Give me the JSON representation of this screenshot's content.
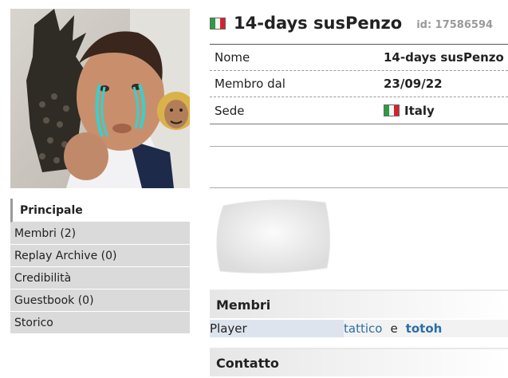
{
  "profile": {
    "title": "14-days susPenzo",
    "id_label": "id: 17586594",
    "country_flag": "italy-flag-icon"
  },
  "info": {
    "rows": [
      {
        "label": "Nome",
        "value": "14-days susPenzo"
      },
      {
        "label": "Membro dal",
        "value": "23/09/22"
      },
      {
        "label": "Sede",
        "value": "Italy"
      }
    ]
  },
  "sidebar": {
    "items": [
      {
        "label": "Principale",
        "active": true
      },
      {
        "label": "Membri (2)"
      },
      {
        "label": "Replay Archive (0)"
      },
      {
        "label": "Credibilità"
      },
      {
        "label": "Guestbook (0)"
      },
      {
        "label": "Storico"
      }
    ]
  },
  "members": {
    "heading": "Membri",
    "role": "Player",
    "players": [
      "tattico",
      "totoh"
    ],
    "separator": "e"
  },
  "contact": {
    "heading": "Contatto"
  },
  "colors": {
    "link": "#2a6ea6",
    "nav_bg": "#dadada",
    "id_grey": "#9a9a9a"
  }
}
